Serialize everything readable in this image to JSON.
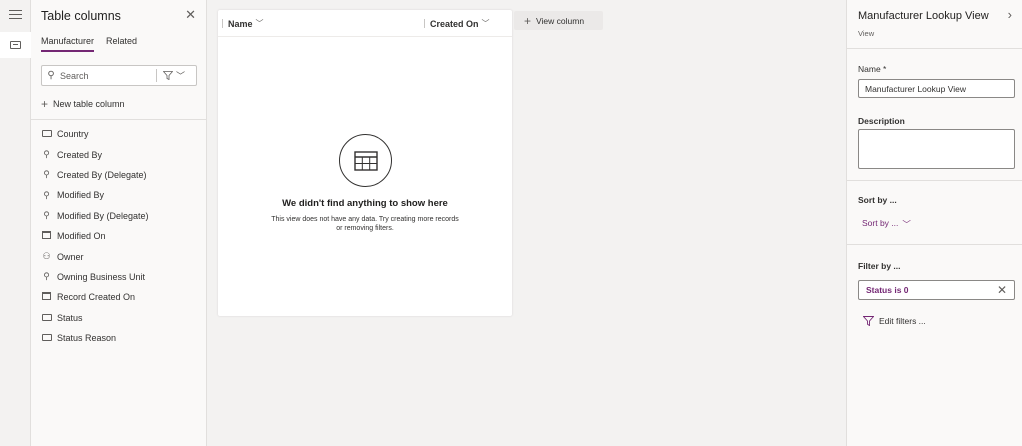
{
  "left_panel": {
    "title": "Table columns",
    "tabs": [
      {
        "label": "Manufacturer",
        "active": true
      },
      {
        "label": "Related",
        "active": false
      }
    ],
    "search_placeholder": "Search",
    "new_column_label": "New table column",
    "columns": [
      {
        "label": "Country",
        "icon": "textbox-icon"
      },
      {
        "label": "Created By",
        "icon": "lookup-icon"
      },
      {
        "label": "Created By (Delegate)",
        "icon": "lookup-icon"
      },
      {
        "label": "Modified By",
        "icon": "lookup-icon"
      },
      {
        "label": "Modified By (Delegate)",
        "icon": "lookup-icon"
      },
      {
        "label": "Modified On",
        "icon": "calendar-clock-icon"
      },
      {
        "label": "Owner",
        "icon": "person-icon"
      },
      {
        "label": "Owning Business Unit",
        "icon": "lookup-icon"
      },
      {
        "label": "Record Created On",
        "icon": "calendar-icon"
      },
      {
        "label": "Status",
        "icon": "textbox-icon"
      },
      {
        "label": "Status Reason",
        "icon": "textbox-icon"
      }
    ]
  },
  "grid": {
    "columns": [
      "Name",
      "Created On"
    ],
    "empty_title": "We didn't find anything to show here",
    "empty_message": "This view does not have any data. Try creating more records or removing filters.",
    "add_column_label": "View column"
  },
  "right_panel": {
    "title": "Manufacturer Lookup View",
    "subtitle": "View",
    "name_label": "Name *",
    "name_value": "Manufacturer Lookup View",
    "description_label": "Description",
    "description_value": "",
    "sort_label": "Sort by ...",
    "sort_link": "Sort by ...",
    "filter_label": "Filter by ...",
    "filter_chip": "Status is 0",
    "edit_filters_label": "Edit filters ..."
  },
  "colors": {
    "accent": "#742774",
    "background": "#f3f2f1",
    "panel": "#faf9f8"
  }
}
